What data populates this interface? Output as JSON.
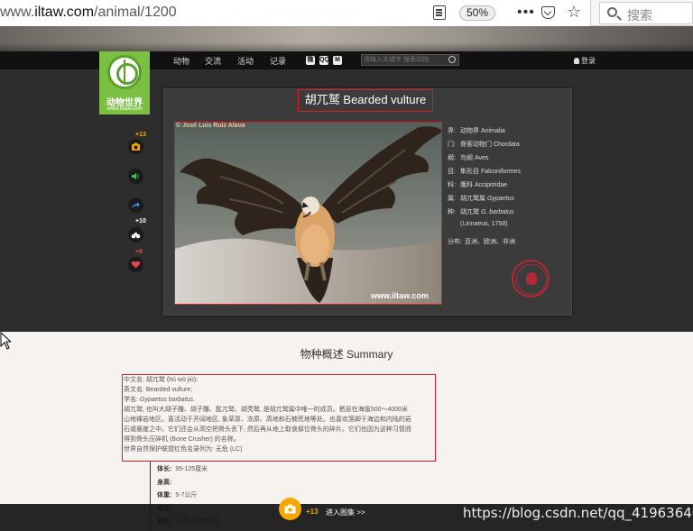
{
  "browser": {
    "url_prefix": "www.",
    "url_domain": "iltaw.com",
    "url_path": "/animal/1200",
    "zoom": "50%",
    "search_placeholder": "搜索"
  },
  "site": {
    "logo_title": "动物世界",
    "logo_url": "www.iltaw.com",
    "nav": [
      "动物",
      "交流",
      "活动",
      "记录"
    ],
    "social": [
      "微",
      "QQ",
      "M"
    ],
    "search_placeholder": "请输入关键字 搜索动物",
    "login": "登录"
  },
  "side_actions": {
    "photo_count": "+13",
    "sighting_count": "+10",
    "like_count": "+8"
  },
  "species": {
    "title": "胡兀鹫  Bearded vulture",
    "photo_credit": "© José Luis Ruiz Alava",
    "watermark": "www.iltaw.com"
  },
  "taxonomy": [
    {
      "key": "界:",
      "value": "动物界 Animalia",
      "latin": ""
    },
    {
      "key": "门:",
      "value": "脊索动物门 Chordata",
      "latin": ""
    },
    {
      "key": "纲:",
      "value": "鸟纲 Aves",
      "latin": ""
    },
    {
      "key": "目:",
      "value": "隼形目 Falconiformes",
      "latin": ""
    },
    {
      "key": "科:",
      "value": "鹰科 Accipitridae",
      "latin": ""
    },
    {
      "key": "属:",
      "value": "胡兀鹫属 ",
      "latin": "Gypaetus"
    },
    {
      "key": "种:",
      "value": "胡兀鹫 ",
      "latin": "G. barbatus"
    },
    {
      "key": "",
      "value": "(Linnaeus, 1758)",
      "latin": ""
    }
  ],
  "distribution": {
    "key": "分布:",
    "value": "亚洲、欧洲、非洲"
  },
  "summary": {
    "heading": "物种概述 Summary",
    "lines": [
      "中文名: 胡兀鹫 (hú wū jiù);",
      "英文名: Bearded vulture;",
      "学名: ",
      "胡兀鹫, 也叫大胡子雕、胡子雕、髭兀鹫、胡秃鹫, 是胡兀鹫属中唯一的成员。栖息在海拔500～4000米",
      "山地裸岩地区。喜活动于开阔地区, 象草原、冻原、高地和石楠荒地等处。也喜欢落脚于海边和内陆的岩",
      "石或悬崖之中。它们还会从高空把骨头丢下, 然后再从地上取食部位骨头的碎片。它们也因为这种习惯而",
      "得到骨头压碎机 (Bone Crusher) 的名称。",
      "世界自然保护联盟红色名录列为: 无危 (LC)"
    ],
    "sci_name": "Gypaetus barbatus."
  },
  "facts": [
    {
      "key": "体长:",
      "value": "95-125厘米"
    },
    {
      "key": "身高:",
      "value": ""
    },
    {
      "key": "体重:",
      "value": "5-7公斤"
    },
    {
      "key": "体征:",
      "value": ""
    },
    {
      "key": "食性:",
      "value": "主要以腐骨为食"
    }
  ],
  "bottom": {
    "count": "+13",
    "label": "进入图集 >>"
  },
  "csdn_watermark": "https://blog.csdn.net/qq_41963640"
}
